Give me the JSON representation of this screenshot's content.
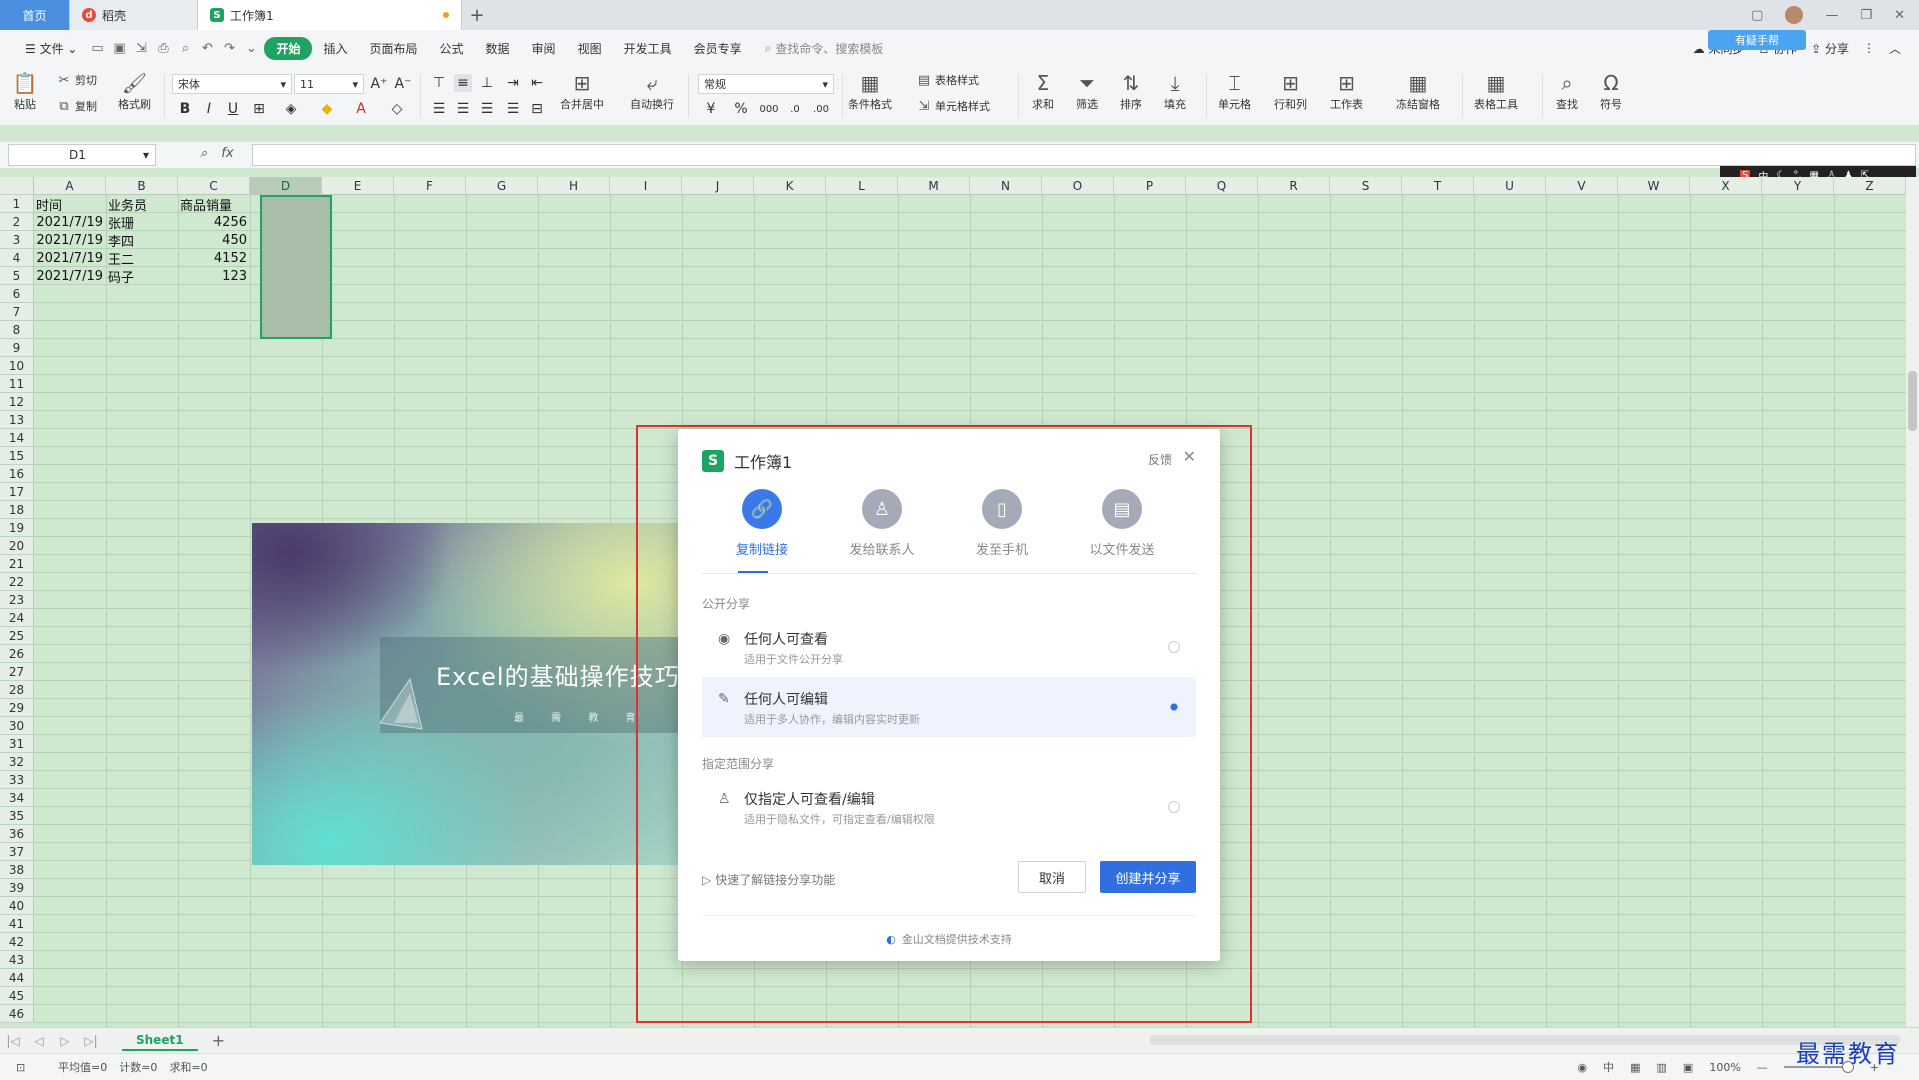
{
  "tabs": {
    "home": "首页",
    "doc1": "稻壳",
    "active": "工作簿1",
    "active_icon": "S"
  },
  "menu": {
    "file": "文件",
    "items": [
      "开始",
      "插入",
      "页面布局",
      "公式",
      "数据",
      "审阅",
      "视图",
      "开发工具",
      "会员专享"
    ],
    "search": "查找命令、搜索模板",
    "right": [
      "未同步",
      "协作",
      "分享"
    ],
    "cloud_badge": "有疑手帮"
  },
  "ribbon": {
    "paste": "粘贴",
    "cut": "剪切",
    "copy": "复制",
    "format_painter": "格式刷",
    "font_name": "宋体",
    "font_size": "11",
    "bold": "B",
    "italic": "I",
    "underline": "U",
    "merge_center": "合并居中",
    "wrap_text": "自动换行",
    "number_format": "常规",
    "currency": "¥",
    "percent": "%",
    "conditional_format": "条件格式",
    "table_style": "表格样式",
    "cell_style": "单元格样式",
    "sum": "求和",
    "filter": "筛选",
    "sort": "排序",
    "fill": "填充",
    "cell": "单元格",
    "row_col": "行和列",
    "worksheet": "工作表",
    "freeze": "冻结窗格",
    "table_tools": "表格工具",
    "find": "查找",
    "symbol": "符号"
  },
  "formula_bar": {
    "name_box": "D1",
    "fx": "fx"
  },
  "ime": [
    "S",
    "中",
    "☾",
    "°,",
    "▦",
    "♙",
    "♟",
    "⇱"
  ],
  "grid": {
    "columns": [
      "A",
      "B",
      "C",
      "D",
      "E",
      "F",
      "G",
      "H",
      "I",
      "J",
      "K",
      "L",
      "M",
      "N",
      "O",
      "P",
      "Q",
      "R",
      "S",
      "T",
      "U",
      "V",
      "W",
      "X",
      "Y",
      "Z"
    ],
    "selected_column": "D",
    "row_count": 46,
    "header_row": [
      "时间",
      "业务员",
      "商品销量"
    ],
    "rows": [
      [
        "2021/7/19",
        "张珊",
        "4256"
      ],
      [
        "2021/7/19",
        "李四",
        "450"
      ],
      [
        "2021/7/19",
        "王二",
        "4152"
      ],
      [
        "2021/7/19",
        "码子",
        "123"
      ]
    ]
  },
  "banner": {
    "title": "Excel的基础操作技巧",
    "subtitle": "最 需 教 育"
  },
  "dialog": {
    "icon": "S",
    "title": "工作簿1",
    "feedback": "反馈",
    "close": "✕",
    "share_options": [
      {
        "label": "复制链接",
        "icon": "link-icon",
        "active": true
      },
      {
        "label": "发给联系人",
        "icon": "person-icon",
        "active": false
      },
      {
        "label": "发至手机",
        "icon": "phone-icon",
        "active": false
      },
      {
        "label": "以文件发送",
        "icon": "file-icon",
        "active": false
      }
    ],
    "public_section": "公开分享",
    "perm_view_title": "任何人可查看",
    "perm_view_desc": "适用于文件公开分享",
    "perm_edit_title": "任何人可编辑",
    "perm_edit_desc": "适用于多人协作，编辑内容实时更新",
    "scoped_section": "指定范围分享",
    "perm_scoped_title": "仅指定人可查看/编辑",
    "perm_scoped_desc": "适用于隐私文件，可指定查看/编辑权限",
    "selected_perm": "任何人可编辑",
    "quick_learn": "快速了解链接分享功能",
    "cancel": "取消",
    "create_share": "创建并分享",
    "footer": "金山文档提供技术支持"
  },
  "sheet": {
    "tab": "Sheet1",
    "add": "+"
  },
  "status": {
    "average": "平均值=0",
    "count": "计数=0",
    "sum": "求和=0",
    "ime": "中",
    "zoom": "100%"
  },
  "watermark": "最需教育",
  "colors": {
    "accent_green": "#1ea362",
    "dialog_blue": "#2f6fe0",
    "grid_bg": "#cfe8cf",
    "annotation_red": "#e03131"
  }
}
